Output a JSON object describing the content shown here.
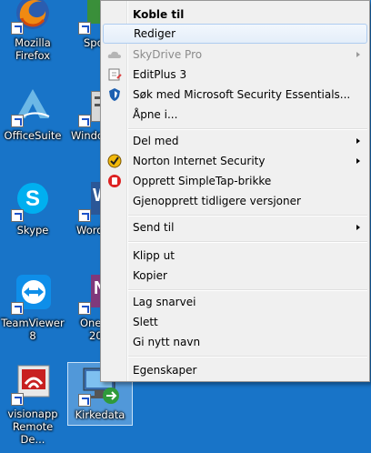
{
  "desktop": {
    "background_color": "#1874c8",
    "icons": [
      {
        "line1": "Mozilla",
        "line2": "Firefox",
        "icon": "firefox-icon"
      },
      {
        "line1": "Spo",
        "line2": "",
        "icon": "sport-app-icon"
      },
      {
        "line1": "OfficeSuite",
        "line2": "",
        "icon": "officesuite-icon"
      },
      {
        "line1": "Windo",
        "line2": "",
        "icon": "windows-app-icon"
      },
      {
        "line1": "Skype",
        "line2": "",
        "icon": "skype-icon"
      },
      {
        "line1": "Word",
        "line2": "",
        "icon": "word-icon"
      },
      {
        "line1": "TeamViewer",
        "line2": "8",
        "icon": "teamviewer-icon"
      },
      {
        "line1": "One",
        "line2": "20",
        "icon": "onenote-icon"
      },
      {
        "line1": "visionapp",
        "line2": "Remote De...",
        "icon": "visionapp-icon"
      },
      {
        "line1": "Kirkedata",
        "line2": "",
        "icon": "remote-desktop-icon"
      }
    ]
  },
  "context_menu": {
    "items": [
      {
        "label": "Koble til",
        "bold": true
      },
      {
        "label": "Rediger",
        "highlighted": true
      },
      {
        "label": "SkyDrive Pro",
        "disabled": true,
        "submenu": true,
        "icon": "cloud-icon"
      },
      {
        "label": "EditPlus 3",
        "icon": "editplus-icon"
      },
      {
        "label": "Søk med Microsoft Security Essentials...",
        "icon": "security-essentials-icon"
      },
      {
        "label": "Åpne i..."
      },
      {
        "label": "Del med",
        "submenu": true
      },
      {
        "label": "Norton Internet Security",
        "submenu": true,
        "icon": "norton-icon"
      },
      {
        "label": "Opprett SimpleTap-brikke",
        "icon": "simpletap-icon"
      },
      {
        "label": "Gjenopprett tidligere versjoner"
      },
      {
        "label": "Send til",
        "submenu": true
      },
      {
        "label": "Klipp ut"
      },
      {
        "label": "Kopier"
      },
      {
        "label": "Lag snarvei"
      },
      {
        "label": "Slett"
      },
      {
        "label": "Gi nytt navn"
      },
      {
        "label": "Egenskaper"
      }
    ]
  }
}
